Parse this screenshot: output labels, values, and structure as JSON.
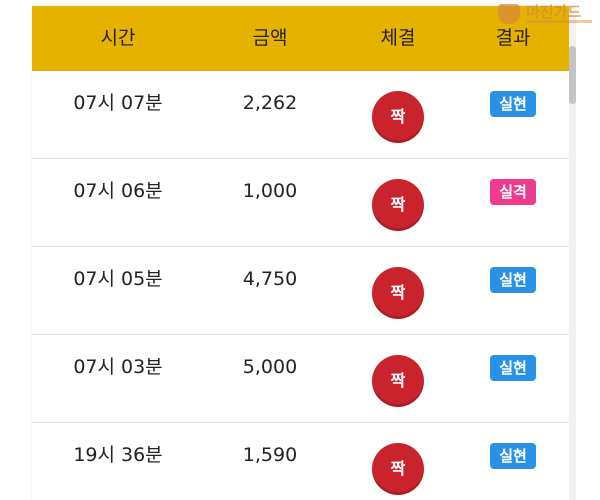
{
  "colors": {
    "header_bg": "#e5b200",
    "result_circle": "#c9242d",
    "badge_hit": "#2a92e6",
    "badge_miss": "#f03a8e",
    "watermark": "#d48a3a"
  },
  "header": {
    "time_label": "시간",
    "amount_label": "금액",
    "bet_label": "체결",
    "result_label": "결과"
  },
  "rows": [
    {
      "time": "07시 07분",
      "amount": "2,262",
      "bet": "짝",
      "result": "실현",
      "result_type": "hit"
    },
    {
      "time": "07시 06분",
      "amount": "1,000",
      "bet": "짝",
      "result": "실격",
      "result_type": "miss"
    },
    {
      "time": "07시 05분",
      "amount": "4,750",
      "bet": "짝",
      "result": "실현",
      "result_type": "hit"
    },
    {
      "time": "07시 03분",
      "amount": "5,000",
      "bet": "짝",
      "result": "실현",
      "result_type": "hit"
    },
    {
      "time": "19시 36분",
      "amount": "1,590",
      "bet": "짝",
      "result": "실현",
      "result_type": "hit"
    }
  ],
  "watermark": {
    "text": "마진가드",
    "icon": "shield-crest-icon"
  }
}
